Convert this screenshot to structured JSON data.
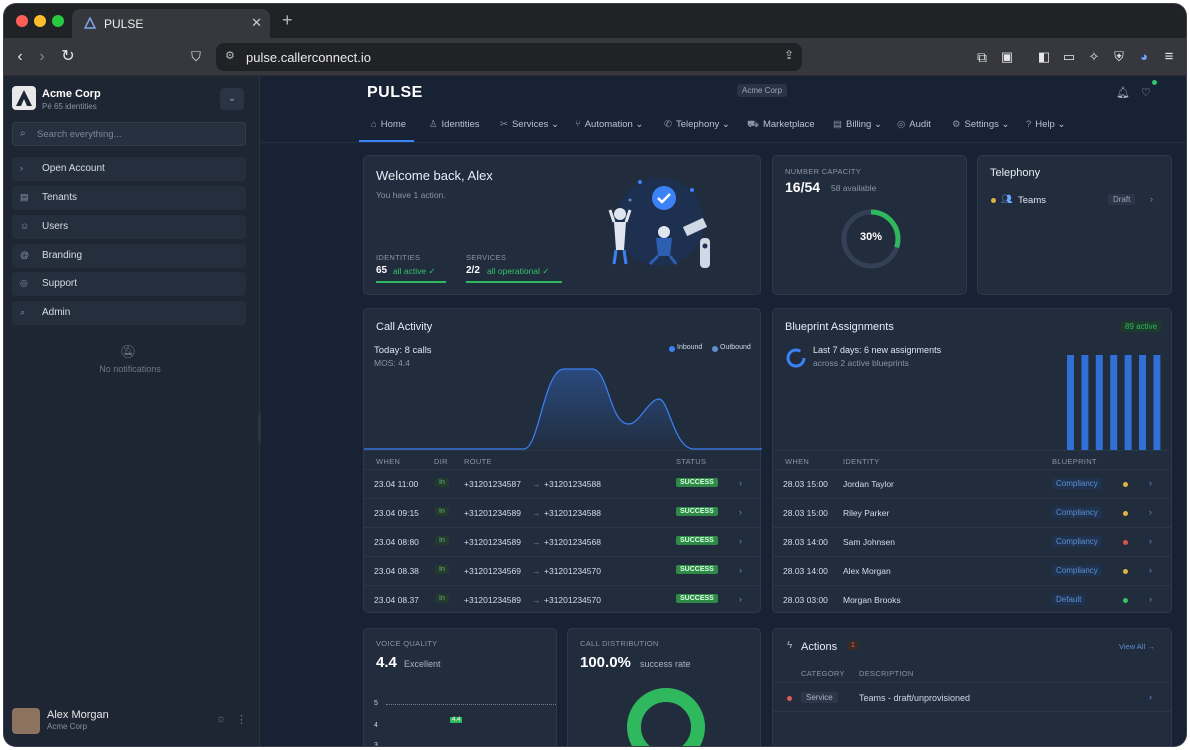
{
  "browser": {
    "tab_title": "PULSE",
    "url": "pulse.callerconnect.io",
    "new_tab": "+",
    "close": "✕"
  },
  "sidebar": {
    "org_name": "Acme Corp",
    "org_sub": "Pé 65 identities",
    "search_placeholder": "Search everything...",
    "items": [
      {
        "label": "Open Account",
        "icon": "›"
      },
      {
        "label": "Tenants",
        "icon": "▤"
      },
      {
        "label": "Users",
        "icon": "☺"
      },
      {
        "label": "Branding",
        "icon": "@"
      },
      {
        "label": "Support",
        "icon": "◎"
      },
      {
        "label": "Admin",
        "icon": "⌕"
      }
    ],
    "notifications": "No notifications",
    "user_name": "Alex Morgan",
    "user_org": "Acme Corp"
  },
  "header": {
    "logo": "PULSE",
    "org_badge": "Acme Corp",
    "nav": [
      {
        "label": "Home",
        "icon": "⌂"
      },
      {
        "label": "Identities",
        "icon": "♙"
      },
      {
        "label": "Services ⌄",
        "icon": "✂"
      },
      {
        "label": "Automation ⌄",
        "icon": "⑂"
      },
      {
        "label": "Telephony ⌄",
        "icon": "✆"
      },
      {
        "label": "Marketplace",
        "icon": "⛟"
      },
      {
        "label": "Billing ⌄",
        "icon": "▤"
      },
      {
        "label": "Audit",
        "icon": "◎"
      },
      {
        "label": "Settings ⌄",
        "icon": "⚙"
      },
      {
        "label": "Help ⌄",
        "icon": "?"
      }
    ]
  },
  "welcome": {
    "title": "Welcome back, Alex",
    "subtitle": "You have 1 action.",
    "identities_label": "IDENTITIES",
    "identities_value": "65",
    "identities_status": "all active ✓",
    "services_label": "SERVICES",
    "services_value": "2/2",
    "services_status": "all operational ✓"
  },
  "capacity": {
    "label": "NUMBER CAPACITY",
    "value": "16/54",
    "sub": "58 available",
    "percent_text": "30%",
    "percent": 0.3
  },
  "telephony": {
    "title": "Telephony",
    "item": "Teams",
    "status": "Draft",
    "chev": "›"
  },
  "call_activity": {
    "title": "Call Activity",
    "today": "Today: 8 calls",
    "mos": "MOS: 4.4",
    "legend_in": "Inbound",
    "legend_out": "Outbound",
    "headers": [
      "WHEN",
      "DIR",
      "ROUTE",
      "STATUS"
    ],
    "rows": [
      {
        "when": "23.04 11:00",
        "dir": "In",
        "from": "+31201234587",
        "to": "+31201234588",
        "status": "SUCCESS"
      },
      {
        "when": "23.04 09:15",
        "dir": "In",
        "from": "+31201234589",
        "to": "+31201234588",
        "status": "SUCCESS"
      },
      {
        "when": "23.04 08:80",
        "dir": "In",
        "from": "+31201234589",
        "to": "+31201234568",
        "status": "SUCCESS"
      },
      {
        "when": "23.04 08.38",
        "dir": "In",
        "from": "+31201234569",
        "to": "+31201234570",
        "status": "SUCCESS"
      },
      {
        "when": "23.04 08.37",
        "dir": "In",
        "from": "+31201234589",
        "to": "+31201234570",
        "status": "SUCCESS"
      }
    ],
    "arrow": "→",
    "chev": "›"
  },
  "blueprint": {
    "title": "Blueprint Assignments",
    "badge": "89 active",
    "summary": "Last 7 days: 6 new assignments",
    "sub": "across 2 active blueprints",
    "headers": [
      "WHEN",
      "IDENTITY",
      "BLUEPRINT"
    ],
    "rows": [
      {
        "when": "28.03 15:00",
        "identity": "Jordan Taylor",
        "blueprint": "Compliancy",
        "dot": "#e0b341"
      },
      {
        "when": "28.03 15:00",
        "identity": "Riley Parker",
        "blueprint": "Compliancy",
        "dot": "#e0b341"
      },
      {
        "when": "28.03 14:00",
        "identity": "Sam Johnsen",
        "blueprint": "Compliancy",
        "dot": "#d9534f"
      },
      {
        "when": "28.03 14:00",
        "identity": "Alex Morgan",
        "blueprint": "Compliancy",
        "dot": "#e0b341"
      },
      {
        "when": "28.03 03:00",
        "identity": "Morgan Brooks",
        "blueprint": "Default",
        "dot": "#35c46a"
      }
    ],
    "bar_count": 7,
    "chev": "›"
  },
  "voice": {
    "label": "VOICE QUALITY",
    "value": "4.4",
    "rating": "Excellent",
    "axis": [
      "5",
      "4",
      "3"
    ],
    "marker": "4.4"
  },
  "distribution": {
    "label": "CALL DISTRIBUTION",
    "value": "100.0%",
    "rating": "success rate"
  },
  "actions": {
    "title": "Actions",
    "count": "1",
    "view_all": "View All →",
    "headers": [
      "CATEGORY",
      "DESCRIPTION"
    ],
    "row": {
      "category": "Service",
      "description": "Teams - draft/unprovisioned"
    },
    "chev": "›"
  },
  "colors": {
    "accent": "#3b82f6",
    "success": "#2fb85e",
    "bg": "#182235"
  }
}
